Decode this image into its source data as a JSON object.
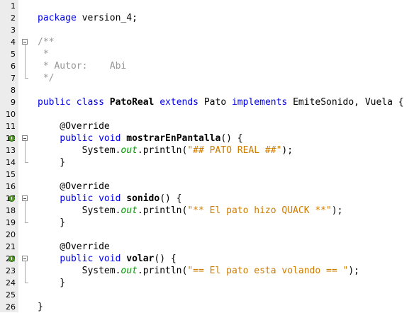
{
  "editor": {
    "lines": [
      {
        "n": "1",
        "tokens": []
      },
      {
        "n": "2",
        "tokens": [
          {
            "t": "package",
            "c": "kw"
          },
          {
            "t": " version_4;",
            "c": ""
          }
        ]
      },
      {
        "n": "3",
        "tokens": []
      },
      {
        "n": "4",
        "tokens": [
          {
            "t": "/**",
            "c": "cmt"
          }
        ]
      },
      {
        "n": "5",
        "tokens": [
          {
            "t": " *",
            "c": "cmt"
          }
        ]
      },
      {
        "n": "6",
        "tokens": [
          {
            "t": " * Autor:    Abi",
            "c": "cmt"
          }
        ]
      },
      {
        "n": "7",
        "tokens": [
          {
            "t": " */",
            "c": "cmt"
          }
        ]
      },
      {
        "n": "8",
        "tokens": []
      },
      {
        "n": "9",
        "tokens": [
          {
            "t": "public",
            "c": "kw"
          },
          {
            "t": " ",
            "c": ""
          },
          {
            "t": "class",
            "c": "kw"
          },
          {
            "t": " ",
            "c": ""
          },
          {
            "t": "PatoReal",
            "c": "bold"
          },
          {
            "t": " ",
            "c": ""
          },
          {
            "t": "extends",
            "c": "kw"
          },
          {
            "t": " Pato ",
            "c": ""
          },
          {
            "t": "implements",
            "c": "kw"
          },
          {
            "t": " EmiteSonido, Vuela {",
            "c": ""
          }
        ]
      },
      {
        "n": "10",
        "tokens": []
      },
      {
        "n": "11",
        "tokens": [
          {
            "t": "    @Override",
            "c": "ann"
          }
        ]
      },
      {
        "n": "12",
        "tokens": [
          {
            "t": "    ",
            "c": ""
          },
          {
            "t": "public",
            "c": "kw"
          },
          {
            "t": " ",
            "c": ""
          },
          {
            "t": "void",
            "c": "kw"
          },
          {
            "t": " ",
            "c": ""
          },
          {
            "t": "mostrarEnPantalla",
            "c": "bold"
          },
          {
            "t": "() {",
            "c": ""
          }
        ]
      },
      {
        "n": "13",
        "tokens": [
          {
            "t": "        System.",
            "c": ""
          },
          {
            "t": "out",
            "c": "ital"
          },
          {
            "t": ".println(",
            "c": ""
          },
          {
            "t": "\"## PATO REAL ##\"",
            "c": "str"
          },
          {
            "t": ");",
            "c": ""
          }
        ]
      },
      {
        "n": "14",
        "tokens": [
          {
            "t": "    }",
            "c": ""
          }
        ]
      },
      {
        "n": "15",
        "tokens": []
      },
      {
        "n": "16",
        "tokens": [
          {
            "t": "    @Override",
            "c": "ann"
          }
        ]
      },
      {
        "n": "17",
        "tokens": [
          {
            "t": "    ",
            "c": ""
          },
          {
            "t": "public",
            "c": "kw"
          },
          {
            "t": " ",
            "c": ""
          },
          {
            "t": "void",
            "c": "kw"
          },
          {
            "t": " ",
            "c": ""
          },
          {
            "t": "sonido",
            "c": "bold"
          },
          {
            "t": "() {",
            "c": ""
          }
        ]
      },
      {
        "n": "18",
        "tokens": [
          {
            "t": "        System.",
            "c": ""
          },
          {
            "t": "out",
            "c": "ital"
          },
          {
            "t": ".println(",
            "c": ""
          },
          {
            "t": "\"** El pato hizo QUACK **\"",
            "c": "str"
          },
          {
            "t": ");",
            "c": ""
          }
        ]
      },
      {
        "n": "19",
        "tokens": [
          {
            "t": "    }",
            "c": ""
          }
        ]
      },
      {
        "n": "20",
        "tokens": []
      },
      {
        "n": "21",
        "tokens": [
          {
            "t": "    @Override",
            "c": "ann"
          }
        ]
      },
      {
        "n": "22",
        "tokens": [
          {
            "t": "    ",
            "c": ""
          },
          {
            "t": "public",
            "c": "kw"
          },
          {
            "t": " ",
            "c": ""
          },
          {
            "t": "void",
            "c": "kw"
          },
          {
            "t": " ",
            "c": ""
          },
          {
            "t": "volar",
            "c": "bold"
          },
          {
            "t": "() {",
            "c": ""
          }
        ]
      },
      {
        "n": "23",
        "tokens": [
          {
            "t": "        System.",
            "c": ""
          },
          {
            "t": "out",
            "c": "ital"
          },
          {
            "t": ".println(",
            "c": ""
          },
          {
            "t": "\"== El pato esta volando == \"",
            "c": "str"
          },
          {
            "t": ");",
            "c": ""
          }
        ]
      },
      {
        "n": "24",
        "tokens": [
          {
            "t": "    }",
            "c": ""
          }
        ]
      },
      {
        "n": "25",
        "tokens": []
      },
      {
        "n": "26",
        "tokens": [
          {
            "t": "}",
            "c": ""
          }
        ]
      }
    ],
    "override_icon_lines": [
      "12",
      "17",
      "22"
    ],
    "fold_box_lines": [
      "4",
      "12",
      "17",
      "22"
    ]
  },
  "colors": {
    "keyword": "#0000e6",
    "comment": "#969696",
    "string": "#ce7b00",
    "static_field": "#009900",
    "gutter": "#ececec"
  },
  "icons": {
    "override": "override-marker-icon",
    "fold": "fold-collapse-icon"
  }
}
